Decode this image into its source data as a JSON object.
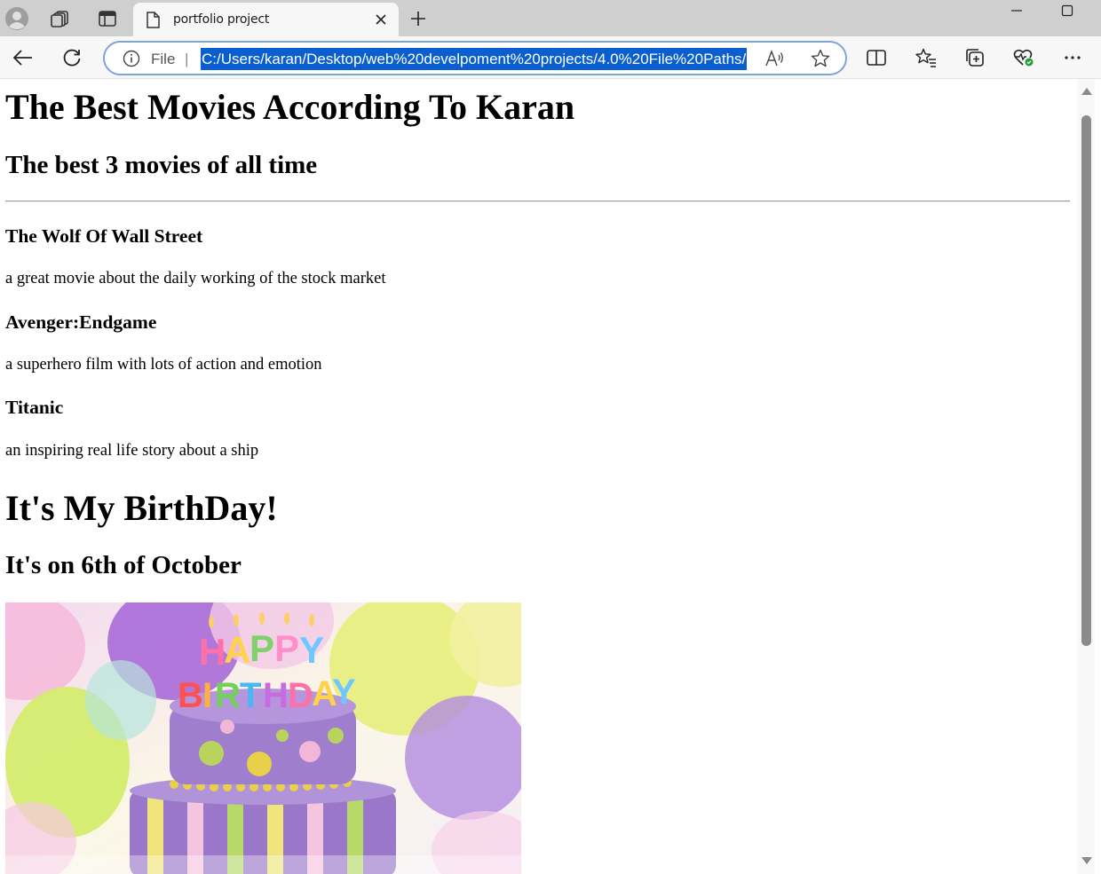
{
  "browser": {
    "tab": {
      "title": "portfolio project"
    },
    "address_bar": {
      "scheme_label": "File",
      "separator": "|",
      "url": "C:/Users/karan/Desktop/web%20develpoment%20projects/4.0%20File%20Paths/"
    },
    "icons": {
      "profile": "avatar-icon",
      "workspaces": "workspaces-icon",
      "vertical_tabs": "vertical-tabs-icon",
      "page": "page-icon",
      "close": "close-icon",
      "new_tab": "plus-icon",
      "minimize": "minimize-icon",
      "maximize": "maximize-icon",
      "back": "back-arrow-icon",
      "reload": "reload-icon",
      "info": "info-icon",
      "read_aloud": "read-aloud-icon",
      "favorite": "star-icon",
      "split": "split-screen-icon",
      "favorites": "favorites-icon",
      "collections": "collections-icon",
      "performance": "heart-pulse-icon",
      "more": "more-icon"
    },
    "colors": {
      "tab_strip": "#cfcfcf",
      "toolbar": "#f7f7f7",
      "url_selection": "#0a5fd0",
      "address_border": "#7fa3d6"
    }
  },
  "page": {
    "title": "The Best Movies According To Karan",
    "subtitle": "The best 3 movies of all time",
    "movies": [
      {
        "title": "The Wolf Of Wall Street",
        "description": "a great movie about the daily working of the stock market"
      },
      {
        "title": "Avenger:Endgame",
        "description": "a superhero film with lots of action and emotion"
      },
      {
        "title": "Titanic",
        "description": "an inspiring real life story about a ship"
      }
    ],
    "birthday": {
      "heading": "It's My BirthDay!",
      "date": "It's on 6th of October",
      "image_text": "HAPPY BIRTHDAY"
    }
  }
}
